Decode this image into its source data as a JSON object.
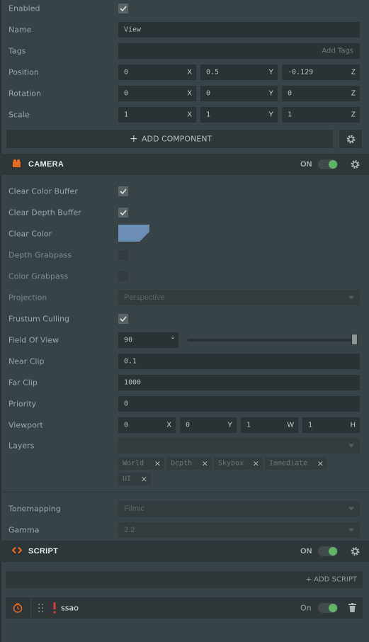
{
  "entity": {
    "enabled_label": "Enabled",
    "name_label": "Name",
    "name_value": "View",
    "tags_label": "Tags",
    "tags_placeholder": "Add Tags",
    "position_label": "Position",
    "position": [
      "0",
      "0.5",
      "-0.129"
    ],
    "rotation_label": "Rotation",
    "rotation": [
      "0",
      "0",
      "0"
    ],
    "scale_label": "Scale",
    "scale": [
      "1",
      "1",
      "1"
    ],
    "axes": [
      "X",
      "Y",
      "Z"
    ],
    "add_component_label": "ADD COMPONENT"
  },
  "camera": {
    "title": "CAMERA",
    "on_label": "ON",
    "clear_color_buffer_label": "Clear Color Buffer",
    "clear_depth_buffer_label": "Clear Depth Buffer",
    "clear_color_label": "Clear Color",
    "clear_color_value": "#6b8fb4",
    "depth_grabpass_label": "Depth Grabpass",
    "color_grabpass_label": "Color Grabpass",
    "projection_label": "Projection",
    "projection_value": "Perspective",
    "frustum_culling_label": "Frustum Culling",
    "fov_label": "Field Of View",
    "fov_value": "90",
    "fov_unit": "°",
    "fov_slider_level": 1.0,
    "near_clip_label": "Near Clip",
    "near_clip_value": "0.1",
    "far_clip_label": "Far Clip",
    "far_clip_value": "1000",
    "priority_label": "Priority",
    "priority_value": "0",
    "viewport_label": "Viewport",
    "viewport": [
      "0",
      "0",
      "1",
      "1"
    ],
    "viewport_axes": [
      "X",
      "Y",
      "W",
      "H"
    ],
    "layers_label": "Layers",
    "layers": [
      "World",
      "Depth",
      "Skybox",
      "Immediate",
      "UI"
    ],
    "tag_remove_glyph": "×",
    "tonemapping_label": "Tonemapping",
    "tonemapping_value": "Filmic",
    "gamma_label": "Gamma",
    "gamma_value": "2.2"
  },
  "script": {
    "title": "SCRIPT",
    "on_label": "ON",
    "add_script_label": "+ ADD SCRIPT",
    "item_name": "ssao",
    "item_on_label": "On"
  },
  "colors": {
    "accent": "#e76b1d",
    "toggle_on": "#5fb465",
    "error": "#e03636"
  }
}
